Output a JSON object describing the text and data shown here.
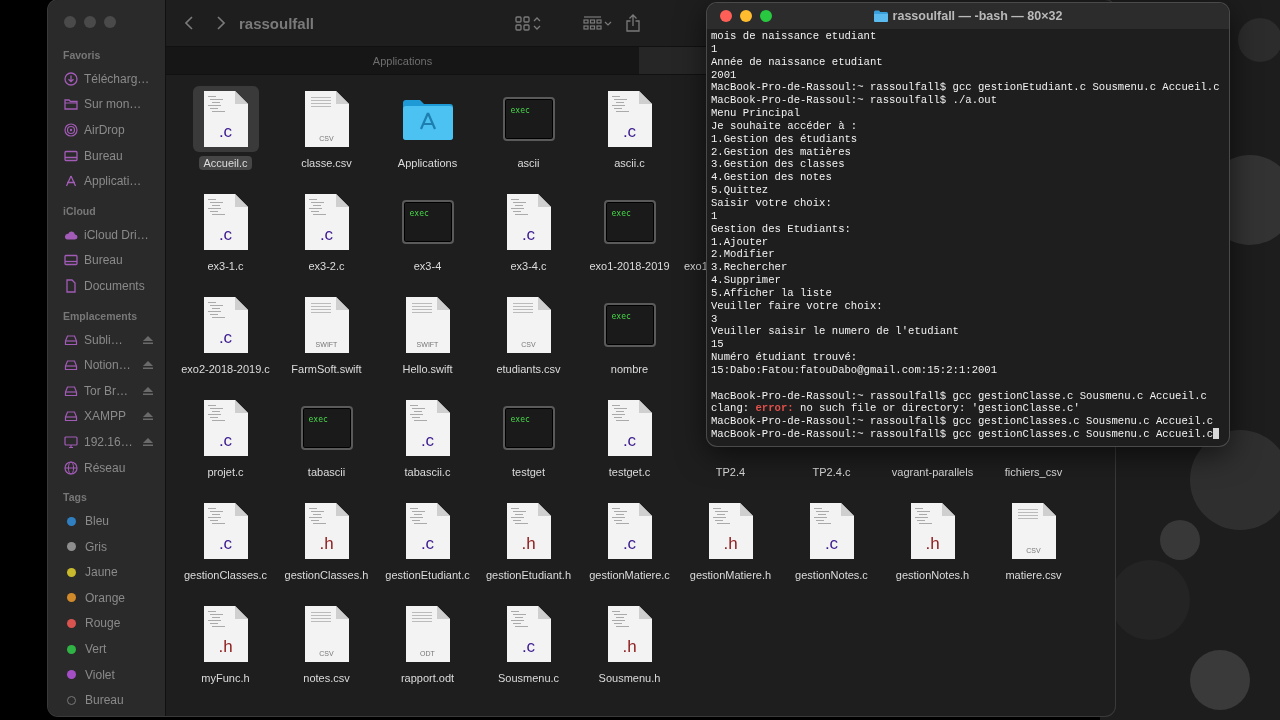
{
  "sidebar": {
    "sections": [
      {
        "title": "Favoris",
        "items": [
          {
            "label": "Télécharg…",
            "kind": "download"
          },
          {
            "label": "Sur mon…",
            "kind": "folder"
          },
          {
            "label": "AirDrop",
            "kind": "airdrop"
          },
          {
            "label": "Bureau",
            "kind": "desktop"
          },
          {
            "label": "Applicati…",
            "kind": "apps"
          }
        ]
      },
      {
        "title": "iCloud",
        "items": [
          {
            "label": "iCloud Dri…",
            "kind": "cloud"
          },
          {
            "label": "Bureau",
            "kind": "desktop"
          },
          {
            "label": "Documents",
            "kind": "document"
          }
        ]
      },
      {
        "title": "Emplacements",
        "items": [
          {
            "label": "Subli…",
            "kind": "drive",
            "ejectable": true
          },
          {
            "label": "Notion…",
            "kind": "drive",
            "ejectable": true
          },
          {
            "label": "Tor Br…",
            "kind": "drive",
            "ejectable": true
          },
          {
            "label": "XAMPP",
            "kind": "drive",
            "ejectable": true
          },
          {
            "label": "192.16…",
            "kind": "monitor",
            "ejectable": true
          },
          {
            "label": "Réseau",
            "kind": "network",
            "ejectable": false
          }
        ]
      },
      {
        "title": "Tags",
        "items": [
          {
            "label": "Bleu",
            "kind": "tag",
            "color": "#2f7fc1"
          },
          {
            "label": "Gris",
            "kind": "tag",
            "color": "#8e8e8e"
          },
          {
            "label": "Jaune",
            "kind": "tag",
            "color": "#c9b92c"
          },
          {
            "label": "Orange",
            "kind": "tag",
            "color": "#d08a2a"
          },
          {
            "label": "Rouge",
            "kind": "tag",
            "color": "#d9534f"
          },
          {
            "label": "Vert",
            "kind": "tag",
            "color": "#2fb344"
          },
          {
            "label": "Violet",
            "kind": "tag",
            "color": "#a54fc7"
          },
          {
            "label": "Bureau",
            "kind": "tag"
          }
        ]
      }
    ]
  },
  "finder": {
    "title": "rassoulfall",
    "tab": "Applications",
    "rows": [
      [
        {
          "name": "Accueil.c",
          "kind": "code",
          "badge": ".c",
          "color": "#3b1a8f",
          "selected": true
        },
        {
          "name": "classe.csv",
          "kind": "data",
          "badge": "CSV",
          "selected": false
        },
        {
          "name": "Applications",
          "kind": "folder",
          "selected": false
        },
        {
          "name": "ascii",
          "kind": "exec",
          "badge": "exec",
          "selected": false
        },
        {
          "name": "ascii.c",
          "kind": "code",
          "badge": ".c",
          "color": "#3b1a8f",
          "selected": false
        }
      ],
      [
        {
          "name": "ex3-1.c",
          "kind": "code",
          "badge": ".c",
          "color": "#3b1a8f",
          "selected": false
        },
        {
          "name": "ex3-2.c",
          "kind": "code",
          "badge": ".c",
          "color": "#3b1a8f",
          "selected": false
        },
        {
          "name": "ex3-4",
          "kind": "exec",
          "badge": "exec",
          "selected": false
        },
        {
          "name": "ex3-4.c",
          "kind": "code",
          "badge": ".c",
          "color": "#3b1a8f",
          "selected": false
        },
        {
          "name": "exo1-2018-2019",
          "kind": "exec",
          "badge": "exec",
          "selected": false
        },
        {
          "name": "exo1",
          "kind": "partial",
          "selected": false
        }
      ],
      [
        {
          "name": "exo2-2018-2019.c",
          "kind": "code",
          "badge": ".c",
          "color": "#3b1a8f",
          "selected": false
        },
        {
          "name": "FarmSoft.swift",
          "kind": "data",
          "badge": "SWIFT",
          "selected": false
        },
        {
          "name": "Hello.swift",
          "kind": "data",
          "badge": "SWIFT",
          "selected": false
        },
        {
          "name": "etudiants.csv",
          "kind": "data",
          "badge": "CSV",
          "selected": false
        },
        {
          "name": "nombre",
          "kind": "exec",
          "badge": "exec",
          "selected": false
        }
      ],
      [
        {
          "name": "projet.c",
          "kind": "code",
          "badge": ".c",
          "color": "#3b1a8f",
          "selected": false
        },
        {
          "name": "tabascii",
          "kind": "exec",
          "badge": "exec",
          "selected": false
        },
        {
          "name": "tabascii.c",
          "kind": "code",
          "badge": ".c",
          "color": "#3b1a8f",
          "selected": false
        },
        {
          "name": "testget",
          "kind": "exec",
          "badge": "exec",
          "selected": false
        },
        {
          "name": "testget.c",
          "kind": "code",
          "badge": ".c",
          "color": "#3b1a8f",
          "selected": false
        },
        {
          "name": "TP2.4",
          "kind": "covered",
          "selected": false
        },
        {
          "name": "TP2.4.c",
          "kind": "covered",
          "selected": false
        },
        {
          "name": "vagrant-parallels",
          "kind": "covered",
          "selected": false
        },
        {
          "name": "fichiers_csv",
          "kind": "covered",
          "selected": false
        }
      ],
      [
        {
          "name": "gestionClasses.c",
          "kind": "code",
          "badge": ".c",
          "color": "#3b1a8f",
          "selected": false
        },
        {
          "name": "gestionClasses.h",
          "kind": "code",
          "badge": ".h",
          "color": "#8e1b1b",
          "selected": false
        },
        {
          "name": "gestionEtudiant.c",
          "kind": "code",
          "badge": ".c",
          "color": "#3b1a8f",
          "selected": false
        },
        {
          "name": "gestionEtudiant.h",
          "kind": "code",
          "badge": ".h",
          "color": "#8e1b1b",
          "selected": false
        },
        {
          "name": "gestionMatiere.c",
          "kind": "code",
          "badge": ".c",
          "color": "#3b1a8f",
          "selected": false
        },
        {
          "name": "gestionMatiere.h",
          "kind": "code",
          "badge": ".h",
          "color": "#8e1b1b",
          "selected": false
        },
        {
          "name": "gestionNotes.c",
          "kind": "code",
          "badge": ".c",
          "color": "#3b1a8f",
          "selected": false
        },
        {
          "name": "gestionNotes.h",
          "kind": "code",
          "badge": ".h",
          "color": "#8e1b1b",
          "selected": false
        },
        {
          "name": "matiere.csv",
          "kind": "data",
          "badge": "CSV",
          "selected": false
        }
      ],
      [
        {
          "name": "myFunc.h",
          "kind": "code",
          "badge": ".h",
          "color": "#8e1b1b",
          "selected": false
        },
        {
          "name": "notes.csv",
          "kind": "data",
          "badge": "CSV",
          "selected": false
        },
        {
          "name": "rapport.odt",
          "kind": "data",
          "badge": "ODT",
          "selected": false
        },
        {
          "name": "Sousmenu.c",
          "kind": "code",
          "badge": ".c",
          "color": "#3b1a8f",
          "selected": false
        },
        {
          "name": "Sousmenu.h",
          "kind": "code",
          "badge": ".h",
          "color": "#8e1b1b",
          "selected": false
        }
      ]
    ]
  },
  "terminal": {
    "title": "rassoulfall — -bash — 80×32",
    "lines": [
      {
        "kind": "text",
        "text": "mois de naissance etudiant"
      },
      {
        "kind": "text",
        "text": "1"
      },
      {
        "kind": "text",
        "text": "Année de naissance etudiant"
      },
      {
        "kind": "text",
        "text": "2001"
      },
      {
        "kind": "text",
        "text": "MacBook-Pro-de-Rassoul:~ rassoulfall$ gcc gestionEtudiant.c Sousmenu.c Accueil.c"
      },
      {
        "kind": "text",
        "text": "MacBook-Pro-de-Rassoul:~ rassoulfall$ ./a.out"
      },
      {
        "kind": "text",
        "text": "Menu Principal"
      },
      {
        "kind": "text",
        "text": "Je souhaite accéder à :"
      },
      {
        "kind": "text",
        "text": "1.Gestion des étudiants"
      },
      {
        "kind": "text",
        "text": "2.Gestion des matières"
      },
      {
        "kind": "text",
        "text": "3.Gestion des classes"
      },
      {
        "kind": "text",
        "text": "4.Gestion des notes"
      },
      {
        "kind": "text",
        "text": "5.Quittez"
      },
      {
        "kind": "text",
        "text": "Saisir votre choix:"
      },
      {
        "kind": "text",
        "text": "1"
      },
      {
        "kind": "text",
        "text": "Gestion des Etudiants:"
      },
      {
        "kind": "text",
        "text": "1.Ajouter"
      },
      {
        "kind": "text",
        "text": "2.Modifier"
      },
      {
        "kind": "text",
        "text": "3.Rechercher"
      },
      {
        "kind": "text",
        "text": "4.Supprimer"
      },
      {
        "kind": "text",
        "text": "5.Afficher la liste"
      },
      {
        "kind": "text",
        "text": "Veuiller faire votre choix:"
      },
      {
        "kind": "text",
        "text": "3"
      },
      {
        "kind": "text",
        "text": "Veuiller saisir le numero de l'etudiant"
      },
      {
        "kind": "text",
        "text": "15"
      },
      {
        "kind": "text",
        "text": "Numéro étudiant trouvé:"
      },
      {
        "kind": "text",
        "text": "15:Dabo:Fatou:fatouDabo@gmail.com:15:2:1:2001"
      },
      {
        "kind": "blank"
      },
      {
        "kind": "text",
        "text": "MacBook-Pro-de-Rassoul:~ rassoulfall$ gcc gestionClasse.c Sousmenu.c Accueil.c"
      },
      {
        "kind": "error",
        "prefix": "clang: ",
        "label": "error:",
        "message": " no such file or directory: 'gestionClasse.c'"
      },
      {
        "kind": "text",
        "text": "MacBook-Pro-de-Rassoul:~ rassoulfall$ gcc gestionClasses.c Sousmenu.c Accueil.c"
      },
      {
        "kind": "text",
        "text": "MacBook-Pro-de-Rassoul:~ rassoulfall$ gcc gestionClasses.c Sousmenu.c Accueil.c",
        "cursor": true
      }
    ]
  }
}
